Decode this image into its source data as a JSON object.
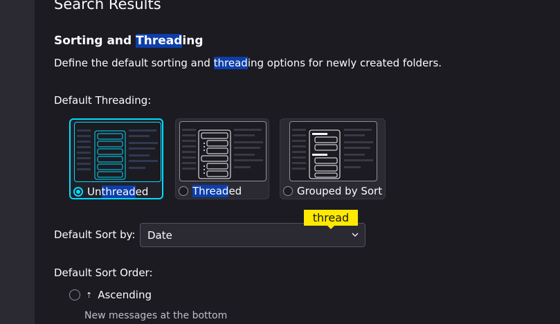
{
  "page": {
    "title": "Search Results"
  },
  "section": {
    "title_pre": "Sorting and ",
    "title_hl": "Thread",
    "title_post": "ing",
    "desc_pre": "Define the default sorting and ",
    "desc_hl": "thread",
    "desc_post": "ing options for newly created folders."
  },
  "threading": {
    "label": "Default Threading:",
    "options": [
      {
        "pre": "Un",
        "hl": "thread",
        "post": "ed",
        "selected": true
      },
      {
        "pre": "",
        "hl": "Thread",
        "post": "ed",
        "selected": false
      },
      {
        "pre": "Grouped by Sort",
        "hl": "",
        "post": "",
        "selected": false
      }
    ]
  },
  "sort": {
    "label": "Default Sort by:",
    "value": "Date"
  },
  "tooltip": {
    "text": "thread"
  },
  "order": {
    "label": "Default Sort Order:",
    "ascending_label": "Ascending",
    "ascending_icon": "sort-ascending-icon",
    "ascending_desc": "New messages at the bottom"
  },
  "colors": {
    "accent": "#00ddff",
    "highlight": "#0d3faa",
    "tooltip": "#ffe900",
    "background": "#1c1b22"
  }
}
